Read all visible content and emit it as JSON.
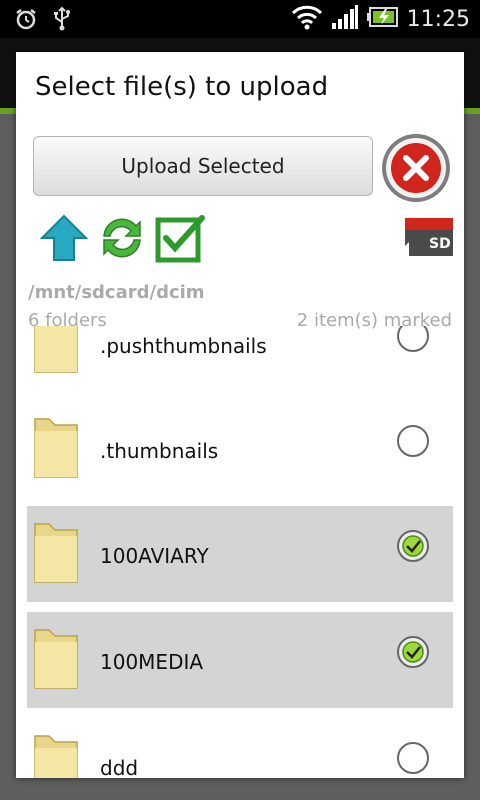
{
  "status_bar": {
    "time": "11:25",
    "left_icons": [
      "alarm-icon",
      "usb-icon"
    ],
    "right_icons": [
      "wifi-icon",
      "signal-icon",
      "battery-charging-icon"
    ]
  },
  "dialog": {
    "title": "Select file(s) to upload",
    "upload_button_label": "Upload Selected",
    "close_icon": "close-icon",
    "toolbar_icons": [
      "up-arrow-icon",
      "refresh-icon",
      "check-all-icon"
    ],
    "sd_card_label": "SD",
    "path": "/mnt/sdcard/dcim",
    "folder_count": "6 folders",
    "marked_count": "2 item(s) marked",
    "items": [
      {
        "name": ".pushthumbnails",
        "checked": false
      },
      {
        "name": ".thumbnails",
        "checked": false
      },
      {
        "name": "100AVIARY",
        "checked": true
      },
      {
        "name": "100MEDIA",
        "checked": true
      },
      {
        "name": "ddd",
        "checked": false
      }
    ]
  },
  "colors": {
    "accent_green": "#6aa121",
    "selected_row": "#d4d4d4",
    "close_red": "#d0261d"
  }
}
